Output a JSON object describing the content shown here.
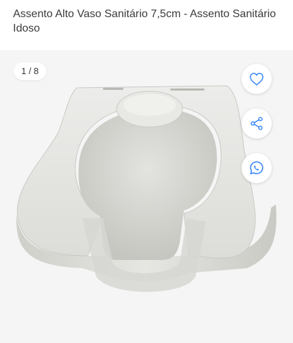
{
  "product": {
    "title": "Assento Alto Vaso Sanitário 7,5cm - Assento Sanitário Idoso"
  },
  "gallery": {
    "counter": "1 / 8"
  },
  "actions": {
    "favorite_icon": "heart-icon",
    "share_icon": "share-icon",
    "whatsapp_icon": "whatsapp-icon"
  },
  "colors": {
    "accent": "#3483fa",
    "gallery_background": "#f5f5f5"
  }
}
